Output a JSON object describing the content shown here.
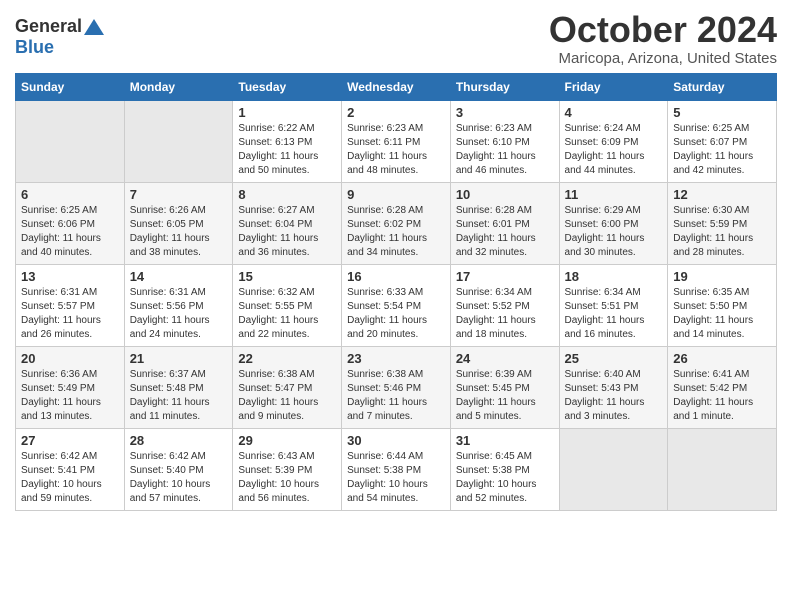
{
  "header": {
    "logo_general": "General",
    "logo_blue": "Blue",
    "title": "October 2024",
    "location": "Maricopa, Arizona, United States"
  },
  "days_of_week": [
    "Sunday",
    "Monday",
    "Tuesday",
    "Wednesday",
    "Thursday",
    "Friday",
    "Saturday"
  ],
  "weeks": [
    [
      {
        "day": "",
        "sunrise": "",
        "sunset": "",
        "daylight": "",
        "empty": true
      },
      {
        "day": "",
        "sunrise": "",
        "sunset": "",
        "daylight": "",
        "empty": true
      },
      {
        "day": "1",
        "sunrise": "Sunrise: 6:22 AM",
        "sunset": "Sunset: 6:13 PM",
        "daylight": "Daylight: 11 hours and 50 minutes."
      },
      {
        "day": "2",
        "sunrise": "Sunrise: 6:23 AM",
        "sunset": "Sunset: 6:11 PM",
        "daylight": "Daylight: 11 hours and 48 minutes."
      },
      {
        "day": "3",
        "sunrise": "Sunrise: 6:23 AM",
        "sunset": "Sunset: 6:10 PM",
        "daylight": "Daylight: 11 hours and 46 minutes."
      },
      {
        "day": "4",
        "sunrise": "Sunrise: 6:24 AM",
        "sunset": "Sunset: 6:09 PM",
        "daylight": "Daylight: 11 hours and 44 minutes."
      },
      {
        "day": "5",
        "sunrise": "Sunrise: 6:25 AM",
        "sunset": "Sunset: 6:07 PM",
        "daylight": "Daylight: 11 hours and 42 minutes."
      }
    ],
    [
      {
        "day": "6",
        "sunrise": "Sunrise: 6:25 AM",
        "sunset": "Sunset: 6:06 PM",
        "daylight": "Daylight: 11 hours and 40 minutes."
      },
      {
        "day": "7",
        "sunrise": "Sunrise: 6:26 AM",
        "sunset": "Sunset: 6:05 PM",
        "daylight": "Daylight: 11 hours and 38 minutes."
      },
      {
        "day": "8",
        "sunrise": "Sunrise: 6:27 AM",
        "sunset": "Sunset: 6:04 PM",
        "daylight": "Daylight: 11 hours and 36 minutes."
      },
      {
        "day": "9",
        "sunrise": "Sunrise: 6:28 AM",
        "sunset": "Sunset: 6:02 PM",
        "daylight": "Daylight: 11 hours and 34 minutes."
      },
      {
        "day": "10",
        "sunrise": "Sunrise: 6:28 AM",
        "sunset": "Sunset: 6:01 PM",
        "daylight": "Daylight: 11 hours and 32 minutes."
      },
      {
        "day": "11",
        "sunrise": "Sunrise: 6:29 AM",
        "sunset": "Sunset: 6:00 PM",
        "daylight": "Daylight: 11 hours and 30 minutes."
      },
      {
        "day": "12",
        "sunrise": "Sunrise: 6:30 AM",
        "sunset": "Sunset: 5:59 PM",
        "daylight": "Daylight: 11 hours and 28 minutes."
      }
    ],
    [
      {
        "day": "13",
        "sunrise": "Sunrise: 6:31 AM",
        "sunset": "Sunset: 5:57 PM",
        "daylight": "Daylight: 11 hours and 26 minutes."
      },
      {
        "day": "14",
        "sunrise": "Sunrise: 6:31 AM",
        "sunset": "Sunset: 5:56 PM",
        "daylight": "Daylight: 11 hours and 24 minutes."
      },
      {
        "day": "15",
        "sunrise": "Sunrise: 6:32 AM",
        "sunset": "Sunset: 5:55 PM",
        "daylight": "Daylight: 11 hours and 22 minutes."
      },
      {
        "day": "16",
        "sunrise": "Sunrise: 6:33 AM",
        "sunset": "Sunset: 5:54 PM",
        "daylight": "Daylight: 11 hours and 20 minutes."
      },
      {
        "day": "17",
        "sunrise": "Sunrise: 6:34 AM",
        "sunset": "Sunset: 5:52 PM",
        "daylight": "Daylight: 11 hours and 18 minutes."
      },
      {
        "day": "18",
        "sunrise": "Sunrise: 6:34 AM",
        "sunset": "Sunset: 5:51 PM",
        "daylight": "Daylight: 11 hours and 16 minutes."
      },
      {
        "day": "19",
        "sunrise": "Sunrise: 6:35 AM",
        "sunset": "Sunset: 5:50 PM",
        "daylight": "Daylight: 11 hours and 14 minutes."
      }
    ],
    [
      {
        "day": "20",
        "sunrise": "Sunrise: 6:36 AM",
        "sunset": "Sunset: 5:49 PM",
        "daylight": "Daylight: 11 hours and 13 minutes."
      },
      {
        "day": "21",
        "sunrise": "Sunrise: 6:37 AM",
        "sunset": "Sunset: 5:48 PM",
        "daylight": "Daylight: 11 hours and 11 minutes."
      },
      {
        "day": "22",
        "sunrise": "Sunrise: 6:38 AM",
        "sunset": "Sunset: 5:47 PM",
        "daylight": "Daylight: 11 hours and 9 minutes."
      },
      {
        "day": "23",
        "sunrise": "Sunrise: 6:38 AM",
        "sunset": "Sunset: 5:46 PM",
        "daylight": "Daylight: 11 hours and 7 minutes."
      },
      {
        "day": "24",
        "sunrise": "Sunrise: 6:39 AM",
        "sunset": "Sunset: 5:45 PM",
        "daylight": "Daylight: 11 hours and 5 minutes."
      },
      {
        "day": "25",
        "sunrise": "Sunrise: 6:40 AM",
        "sunset": "Sunset: 5:43 PM",
        "daylight": "Daylight: 11 hours and 3 minutes."
      },
      {
        "day": "26",
        "sunrise": "Sunrise: 6:41 AM",
        "sunset": "Sunset: 5:42 PM",
        "daylight": "Daylight: 11 hours and 1 minute."
      }
    ],
    [
      {
        "day": "27",
        "sunrise": "Sunrise: 6:42 AM",
        "sunset": "Sunset: 5:41 PM",
        "daylight": "Daylight: 10 hours and 59 minutes."
      },
      {
        "day": "28",
        "sunrise": "Sunrise: 6:42 AM",
        "sunset": "Sunset: 5:40 PM",
        "daylight": "Daylight: 10 hours and 57 minutes."
      },
      {
        "day": "29",
        "sunrise": "Sunrise: 6:43 AM",
        "sunset": "Sunset: 5:39 PM",
        "daylight": "Daylight: 10 hours and 56 minutes."
      },
      {
        "day": "30",
        "sunrise": "Sunrise: 6:44 AM",
        "sunset": "Sunset: 5:38 PM",
        "daylight": "Daylight: 10 hours and 54 minutes."
      },
      {
        "day": "31",
        "sunrise": "Sunrise: 6:45 AM",
        "sunset": "Sunset: 5:38 PM",
        "daylight": "Daylight: 10 hours and 52 minutes."
      },
      {
        "day": "",
        "sunrise": "",
        "sunset": "",
        "daylight": "",
        "empty": true
      },
      {
        "day": "",
        "sunrise": "",
        "sunset": "",
        "daylight": "",
        "empty": true
      }
    ]
  ]
}
